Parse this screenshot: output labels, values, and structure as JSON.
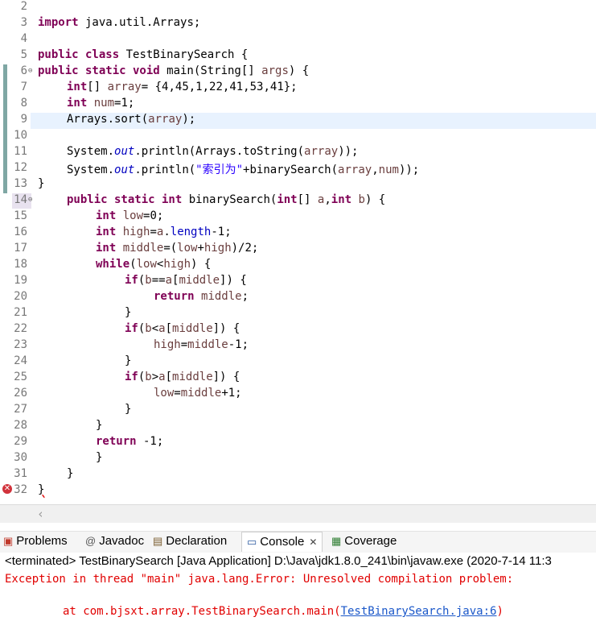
{
  "editor": {
    "lines": [
      {
        "n": "2"
      },
      {
        "n": "3"
      },
      {
        "n": "4"
      },
      {
        "n": "5"
      },
      {
        "n": "6"
      },
      {
        "n": "7"
      },
      {
        "n": "8"
      },
      {
        "n": "9"
      },
      {
        "n": "10"
      },
      {
        "n": "11"
      },
      {
        "n": "12"
      },
      {
        "n": "13"
      },
      {
        "n": "14"
      },
      {
        "n": "15"
      },
      {
        "n": "16"
      },
      {
        "n": "17"
      },
      {
        "n": "18"
      },
      {
        "n": "19"
      },
      {
        "n": "20"
      },
      {
        "n": "21"
      },
      {
        "n": "22"
      },
      {
        "n": "23"
      },
      {
        "n": "24"
      },
      {
        "n": "25"
      },
      {
        "n": "26"
      },
      {
        "n": "27"
      },
      {
        "n": "28"
      },
      {
        "n": "29"
      },
      {
        "n": "30"
      },
      {
        "n": "31"
      },
      {
        "n": "32"
      }
    ],
    "code": {
      "l3a": "import",
      "l3b": " java.util.Arrays;",
      "l5a": "public class",
      "l5b": " TestBinarySearch {",
      "l6a": "public static void",
      "l6b": " main(String[] ",
      "l6c": "args",
      "l6d": ") {",
      "l7a": "int",
      "l7b": "[] ",
      "l7c": "array",
      "l7d": "= {4,45,1,22,41,53,41};",
      "l8a": "int",
      "l8b": " ",
      "l8c": "num",
      "l8d": "=1;",
      "l9a": "Arrays.sort(",
      "l9b": "array",
      "l9c": ");",
      "l11a": "System.",
      "l11b": "out",
      "l11c": ".println(Arrays.toString(",
      "l11d": "array",
      "l11e": "));",
      "l12a": "System.",
      "l12b": "out",
      "l12c": ".println(",
      "l12d": "\"索引为\"",
      "l12e": "+binarySearch(",
      "l12f": "array",
      "l12g": ",",
      "l12h": "num",
      "l12i": "));",
      "l13": "}",
      "l14a": "public static int",
      "l14b": " binarySearch(",
      "l14c": "int",
      "l14d": "[] ",
      "l14e": "a",
      "l14f": ",",
      "l14g": "int",
      "l14h": " ",
      "l14i": "b",
      "l14j": ") {",
      "l15a": "int",
      "l15b": " ",
      "l15c": "low",
      "l15d": "=0;",
      "l16a": "int",
      "l16b": " ",
      "l16c": "high",
      "l16d": "=",
      "l16e": "a",
      "l16f": ".",
      "l16g": "length",
      "l16h": "-1;",
      "l17a": "int",
      "l17b": " ",
      "l17c": "middle",
      "l17d": "=(",
      "l17e": "low",
      "l17f": "+",
      "l17g": "high",
      "l17h": ")/2;",
      "l18a": "while",
      "l18b": "(",
      "l18c": "low",
      "l18d": "<",
      "l18e": "high",
      "l18f": ") {",
      "l19a": "if",
      "l19b": "(",
      "l19c": "b",
      "l19d": "==",
      "l19e": "a",
      "l19f": "[",
      "l19g": "middle",
      "l19h": "]) {",
      "l20a": "return",
      "l20b": " ",
      "l20c": "middle",
      "l20d": ";",
      "l21": "}",
      "l22a": "if",
      "l22b": "(",
      "l22c": "b",
      "l22d": "<",
      "l22e": "a",
      "l22f": "[",
      "l22g": "middle",
      "l22h": "]) {",
      "l23a": "high",
      "l23b": "=",
      "l23c": "middle",
      "l23d": "-1;",
      "l24": "}",
      "l25a": "if",
      "l25b": "(",
      "l25c": "b",
      "l25d": ">",
      "l25e": "a",
      "l25f": "[",
      "l25g": "middle",
      "l25h": "]) {",
      "l26a": "low",
      "l26b": "=",
      "l26c": "middle",
      "l26d": "+1;",
      "l27": "}",
      "l28": "}",
      "l29a": "return",
      "l29b": " -1;",
      "l30": "}",
      "l31": "}",
      "l32": "}"
    }
  },
  "tabs": [
    {
      "label": "Problems",
      "icon": "problems-icon"
    },
    {
      "label": "Javadoc",
      "icon": "at-icon"
    },
    {
      "label": "Declaration",
      "icon": "declaration-icon"
    },
    {
      "label": "Console",
      "icon": "console-icon"
    },
    {
      "label": "Coverage",
      "icon": "coverage-icon"
    }
  ],
  "console": {
    "header": "<terminated> TestBinarySearch [Java Application] D:\\Java\\jdk1.8.0_241\\bin\\javaw.exe  (2020-7-14 11:3",
    "line1": "Exception in thread \"main\" java.lang.Error: Unresolved compilation problem: ",
    "line2_prefix": "at com.bjsxt.array.TestBinarySearch.main(",
    "line2_link": "TestBinarySearch.java:6",
    "line2_suffix": ")"
  },
  "colors": {
    "keyword": "#7f0055",
    "string": "#2a00ff",
    "field": "#0000c0",
    "local_var": "#6a3e3e",
    "error": "#e10000",
    "link": "#1a57c9"
  }
}
